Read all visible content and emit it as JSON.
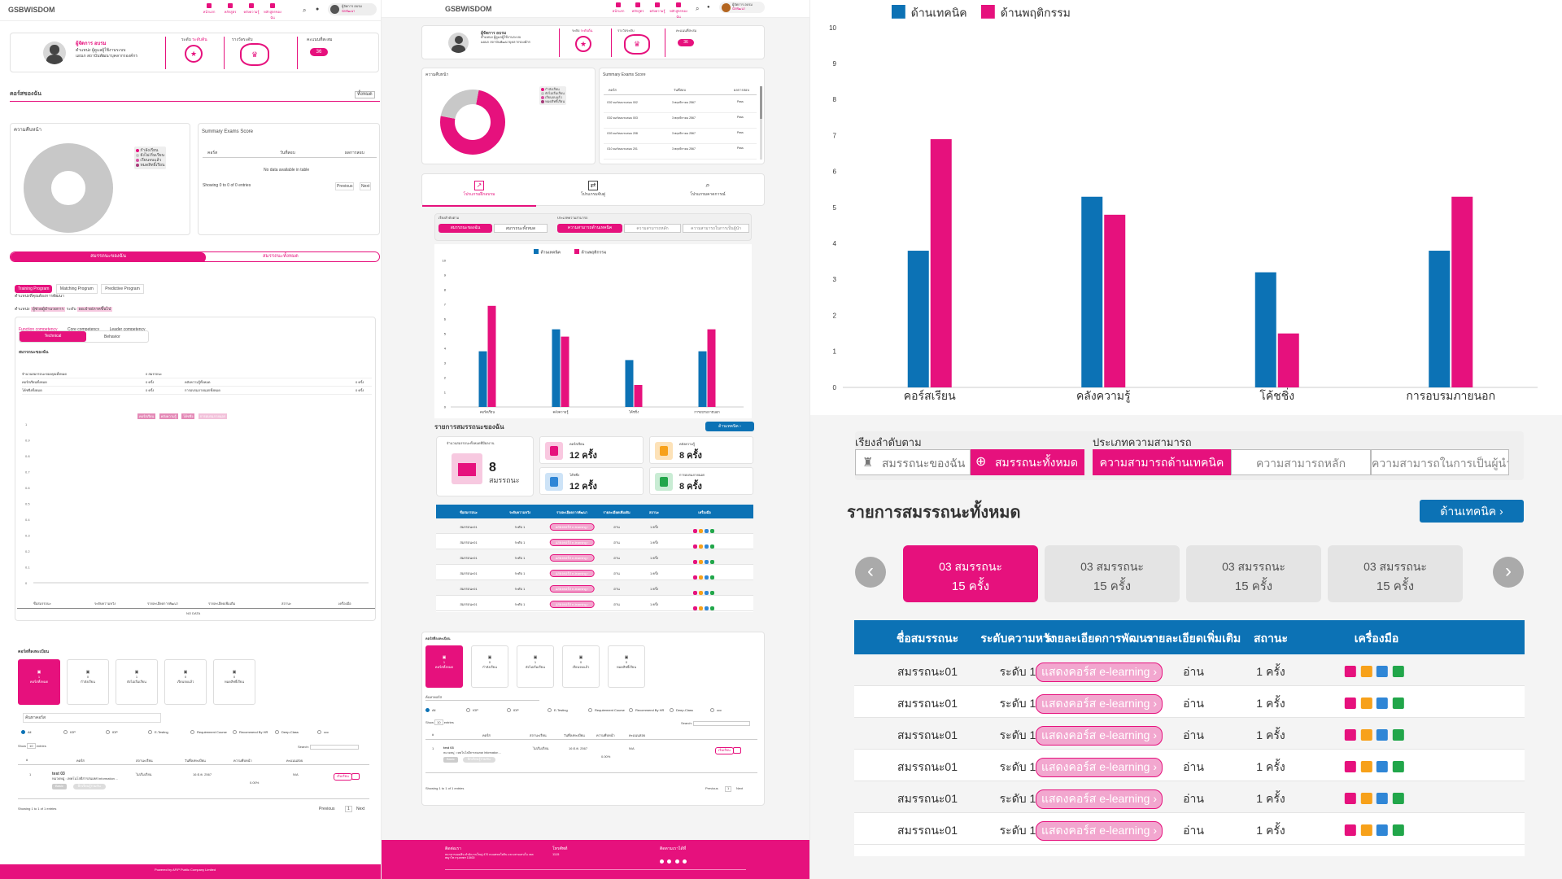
{
  "app": {
    "logo_a": "GSB",
    "logo_b": "WISDOM"
  },
  "nav": {
    "items": [
      "หน้าแรก",
      "หลักสูตร",
      "คลังความรู้",
      "หลักสูตรของฉัน"
    ],
    "user_name": "ผู้จัดการ อบรม",
    "user_role": "นักพัฒนา"
  },
  "profile": {
    "name": "ผู้จัดการ อบรม",
    "line1": "ตำแหน่ง ผู้ดูแลผู้ใช้งานระบบ",
    "line2": "แผนก สถาบันพัฒนาบุคลากรองค์กร",
    "level_label": "ระดับ",
    "level_value": "ระดับต้น",
    "reward_label": "รางวัลระดับ",
    "score_label": "คะแนนที่สะสม",
    "score_value": "36"
  },
  "left": {
    "my_courses": "คอร์สของฉัน",
    "filter_all": "ทั้งหมด",
    "progress_title": "ความคืบหน้า",
    "legend": [
      "กำลังเรียน",
      "ยังไม่เริ่มเรียน",
      "เรียนจบแล้ว",
      "หมดสิทธิ์เรียน"
    ],
    "summary_title": "Summary Exams Score",
    "summary_cols": [
      "คอร์ส",
      "วันที่สอบ",
      "ผลการสอบ"
    ],
    "no_data": "No data available in table",
    "showing": "Showing 0 to 0 of 0 entries",
    "prev": "Previous",
    "next": "Next",
    "tab_my": "สมรรถนะของฉัน",
    "tab_all": "สมรรถนะทั้งหมด",
    "programs": [
      "Training Program",
      "Matching Program",
      "Predictive Program"
    ],
    "desc": "ตำแหน่งที่คุณต้องการพัฒนา",
    "position_label": "ตำแหน่ง",
    "position_value": "ผู้ช่วยผู้อำนวยการ",
    "level_label": "ระดับ",
    "level_value": "ผอ.ฝ่าย/ภาคขึ้นไป",
    "competency_tabs": [
      "Function competency",
      "Core competency",
      "Leader competency"
    ],
    "tech_btn": "Technical",
    "behav_btn": "Behavior",
    "overview_title": "สมรรถนะของฉัน",
    "stats": [
      [
        "จำนวนสมรรถนะของคุณทั้งหมด",
        "0 สมรรถนะ",
        "",
        ""
      ],
      [
        "คอร์สเรียนทั้งหมด",
        "0 ครั้ง",
        "คลังความรู้ทั้งหมด",
        "0 ครั้ง"
      ],
      [
        "โค้ชชิ่งทั้งหมด",
        "0 ครั้ง",
        "การอบรมภายนอกทั้งหมด",
        "0 ครั้ง"
      ]
    ],
    "chips": [
      "คอร์สเรียน",
      "คลังความรู้",
      "โค้ชชิ่ง",
      "การอบรมภายนอก"
    ],
    "yticks": [
      "1",
      "0.9",
      "0.8",
      "0.7",
      "0.6",
      "0.5",
      "0.4",
      "0.3",
      "0.2",
      "0.1",
      "0"
    ],
    "table_cols": [
      "ชื่อสมรรถนะ",
      "ระดับความหวัง",
      "รายละเอียดการพัฒนา",
      "รายละเอียดเพิ่มเติม",
      "สถานะ",
      "เครื่องมือ"
    ],
    "no_data2": "NO DATA",
    "my_course_title": "คอร์สที่ลงทะเบียน",
    "status_cards": [
      {
        "n": "1",
        "l": "คอร์สทั้งหมด"
      },
      {
        "n": "0",
        "l": "กำลังเรียน"
      },
      {
        "n": "1",
        "l": "ยังไม่เริ่มเรียน"
      },
      {
        "n": "0",
        "l": "เรียนจบแล้ว"
      },
      {
        "n": "0",
        "l": "หมดสิทธิ์เรียน"
      }
    ],
    "search_ph": "ค้นหาคอร์ส",
    "radios": [
      "All",
      "IGP",
      "IDP",
      "E-Testing",
      "Requirement Course",
      "Recommend By HR",
      "Deep-Class",
      "ccc"
    ],
    "show": "Show",
    "entries": "entries",
    "search": "Search:",
    "course_cols": [
      "#",
      "คอร์ส",
      "สถานะเรียน",
      "วันที่ลงทะเบียน",
      "ความคืบหน้า",
      "คะแนนสอบ",
      ""
    ],
    "course_row": {
      "idx": "1",
      "name": "test 03",
      "sub": "หมวดหมู่ : เทคโนโลยีสารสนเทศ Information ...",
      "type": "ไม่เริ่มเรียน",
      "date": "16 ต.ค. 2567",
      "progress": "0.00%",
      "score": "N/A",
      "btn": "เริ่มเรียน",
      "tag1": "Basic",
      "tag2": "ฝึกเรียนรู้ร่วมกัน"
    },
    "showing2": "Showing 1 to 1 of 1 entries",
    "page": "1",
    "powered": "Powered by AFIP Public Company Limited"
  },
  "mid": {
    "progress_title": "ความคืบหน้า",
    "summary_title": "Summary Exams Score",
    "summary_cols": [
      "คอร์ส",
      "วันที่สอบ",
      "ผลการสอบ"
    ],
    "summary_rows": [
      [
        "G02 คอร์สอบรมสอบ 002",
        "3 พฤศจิกายน 2567",
        "Pass"
      ],
      [
        "G02 คอร์สอบรมสอบ 003",
        "3 พฤศจิกายน 2567",
        "Pass"
      ],
      [
        "G03 คอร์สอบรมสอบ 208",
        "3 พฤศจิกายน 2567",
        "Pass"
      ],
      [
        "G10 คอร์สอบรมสอบ 201",
        "3 พฤศจิกายน 2567",
        "Pass"
      ]
    ],
    "program_tabs": [
      "โปรแกรมฝึกอบรม",
      "โปรแกรมจับคู่",
      "โปรแกรมคาดการณ์"
    ],
    "sort_label": "เรียงลำดับตาม",
    "sort_my": "สมรรถนะของฉัน",
    "sort_all": "สมรรถนะทั้งหมด",
    "type_label": "ประเภทความสามารถ",
    "type_opts": [
      "ความสามารถด้านเทคนิค",
      "ความสามารถหลัก",
      "ความสามารถในการเป็นผู้นำ"
    ],
    "list_title": "รายการสมรรถนะของฉัน",
    "tech_btn": "ด้านเทคนิค",
    "total_label": "จำนวนสมรรถนะทั้งหมดที่มีผลงาน",
    "total_value": "8",
    "total_unit": "สมรรถนะ",
    "stat_cards": [
      {
        "l": "คอร์สเรียน",
        "v": "12 ครั้ง"
      },
      {
        "l": "คลังความรู้",
        "v": "8 ครั้ง"
      },
      {
        "l": "โค้ชชิ่ง",
        "v": "12 ครั้ง"
      },
      {
        "l": "การอบรมภายนอก",
        "v": "8 ครั้ง"
      }
    ],
    "course_title": "คอร์สที่ลงทะเบียน",
    "footer": {
      "contact": "ติดต่อเรา",
      "addr": "ธนาคารออมสิน สำนักงานใหญ่ 470 ถนนพหลโยธิน แขวงสามเสนใน เขตพญาไท กรุงเทพฯ 10400",
      "phone": "โทรศัพท์",
      "phone_v": "1115",
      "follow": "ติดตามเราได้ที่"
    }
  },
  "right": {
    "sort_label": "เรียงลำดับตาม",
    "sort_my": "สมรรถนะของฉัน",
    "sort_all": "สมรรถนะทั้งหมด",
    "type_label": "ประเภทความสามารถ",
    "type_opts": [
      "ความสามารถด้านเทคนิค",
      "ความสามารถหลัก",
      "ความสามารถในการเป็นผู้นำ"
    ],
    "list_title": "รายการสมรรถนะทั้งหมด",
    "tech_btn": "ด้านเทคนิค",
    "cards": [
      {
        "l1": "03 สมรรถนะ",
        "l2": "15 ครั้ง"
      },
      {
        "l1": "03 สมรรถนะ",
        "l2": "15 ครั้ง"
      },
      {
        "l1": "03 สมรรถนะ",
        "l2": "15 ครั้ง"
      },
      {
        "l1": "03 สมรรถนะ",
        "l2": "15 ครั้ง"
      }
    ],
    "table_cols": [
      "ชื่อสมรรถนะ",
      "ระดับความหวัง",
      "รายละเอียดการพัฒนา",
      "รายละเอียดเพิ่มเติม",
      "สถานะ",
      "เครื่องมือ"
    ],
    "rows": [
      [
        "สมรรถนะ01",
        "ระดับ 1",
        "แสดงคอร์ส e-learning",
        "อ่าน",
        "1 ครั้ง"
      ],
      [
        "สมรรถนะ01",
        "ระดับ 1",
        "แสดงคอร์ส e-learning",
        "อ่าน",
        "1 ครั้ง"
      ],
      [
        "สมรรถนะ01",
        "ระดับ 1",
        "แสดงคอร์ส e-learning",
        "อ่าน",
        "1 ครั้ง"
      ],
      [
        "สมรรถนะ01",
        "ระดับ 1",
        "แสดงคอร์ส e-learning",
        "อ่าน",
        "1 ครั้ง"
      ],
      [
        "สมรรถนะ01",
        "ระดับ 1",
        "แสดงคอร์ส e-learning",
        "อ่าน",
        "1 ครั้ง"
      ],
      [
        "สมรรถนะ01",
        "ระดับ 1",
        "แสดงคอร์ส e-learning",
        "อ่าน",
        "1 ครั้ง"
      ]
    ]
  },
  "colors": {
    "pink": "#e6117d",
    "blue": "#0c72b5",
    "grey": "#c8c8c8"
  },
  "chart_data": [
    {
      "type": "bar",
      "categories": [
        "คอร์สเรียน",
        "คลังความรู้",
        "โค้ชชิ่ง",
        "การอบรมภายนอก"
      ],
      "series": [
        {
          "name": "ด้านเทคนิค",
          "values": [
            3.8,
            5.3,
            3.2,
            3.8
          ],
          "color": "#0c72b5"
        },
        {
          "name": "ด้านพฤติกรรม",
          "values": [
            6.9,
            4.8,
            1.5,
            5.3
          ],
          "color": "#e6117d"
        }
      ],
      "ylim": [
        0,
        10
      ],
      "yticks": [
        0,
        1,
        2,
        3,
        4,
        5,
        6,
        7,
        8,
        9,
        10
      ],
      "legend": "top"
    },
    {
      "type": "pie",
      "categories": [
        "กำลังเรียน",
        "ยังไม่เริ่มเรียน",
        "เรียนจบแล้ว",
        "หมดสิทธิ์เรียน"
      ],
      "values": [
        75,
        25,
        0,
        0
      ],
      "colors": [
        "#e6117d",
        "#c8c8c8",
        "#d94fa0",
        "#a53c7a"
      ]
    },
    {
      "type": "pie",
      "categories": [
        "กำลังเรียน",
        "ยังไม่เริ่มเรียน",
        "เรียนจบแล้ว",
        "หมดสิทธิ์เรียน"
      ],
      "values": [
        0,
        1,
        0,
        0
      ],
      "colors": [
        "#e6117d",
        "#c8c8c8",
        "#d94fa0",
        "#a53c7a"
      ]
    }
  ]
}
